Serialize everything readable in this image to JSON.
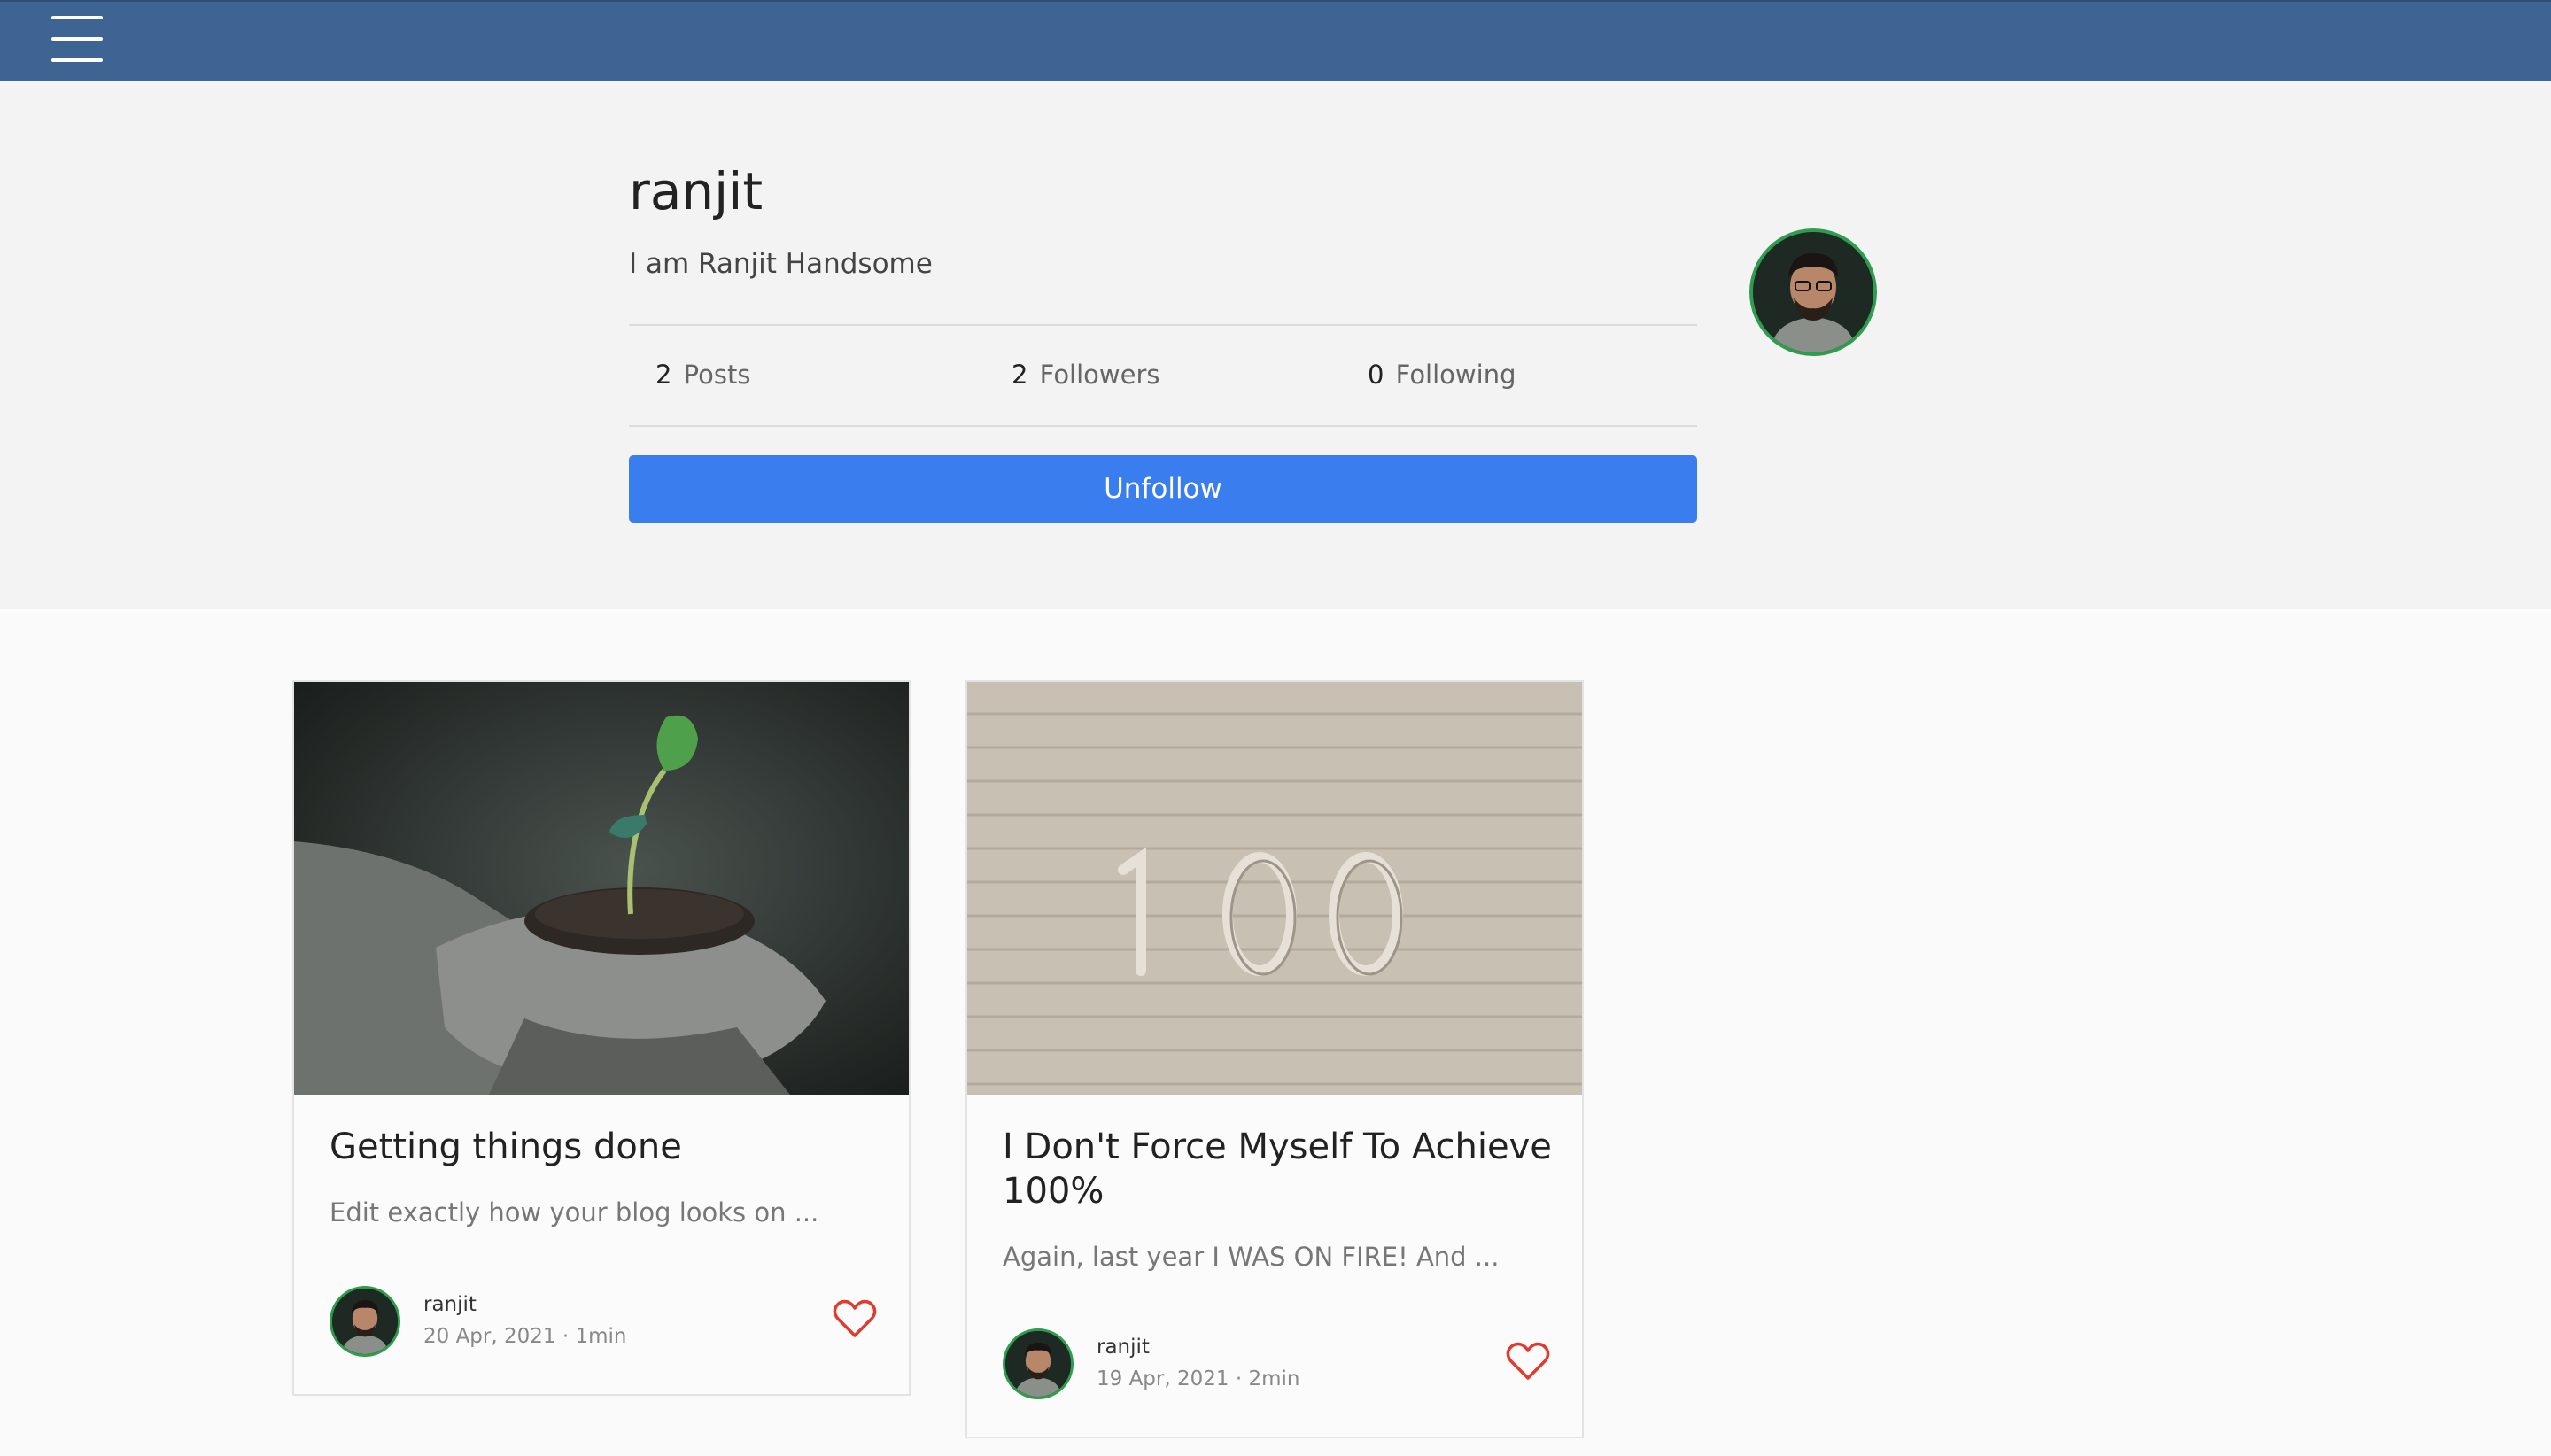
{
  "header": {
    "menu_icon": "hamburger-menu-icon",
    "bar_color": "#3e6494"
  },
  "profile": {
    "name": "ranjit",
    "bio": "I am Ranjit Handsome",
    "stats": [
      {
        "count": "2",
        "label": "Posts"
      },
      {
        "count": "2",
        "label": "Followers"
      },
      {
        "count": "0",
        "label": "Following"
      }
    ],
    "follow_button_label": "Unfollow",
    "accent_color": "#3a7def"
  },
  "posts": [
    {
      "title": "Getting things done",
      "excerpt": "Edit exactly how your blog looks on ...",
      "author": "ranjit",
      "meta": "20 Apr, 2021 · 1min",
      "image": "seedling-in-hands-photo",
      "like_icon": "heart-outline-icon"
    },
    {
      "title": "I Don't Force Myself To Achieve 100%",
      "excerpt": "Again, last year I WAS ON FIRE! And ...",
      "author": "ranjit",
      "meta": "19 Apr, 2021 · 2min",
      "image": "number-100-on-brick-wall-photo",
      "like_icon": "heart-outline-icon"
    }
  ]
}
